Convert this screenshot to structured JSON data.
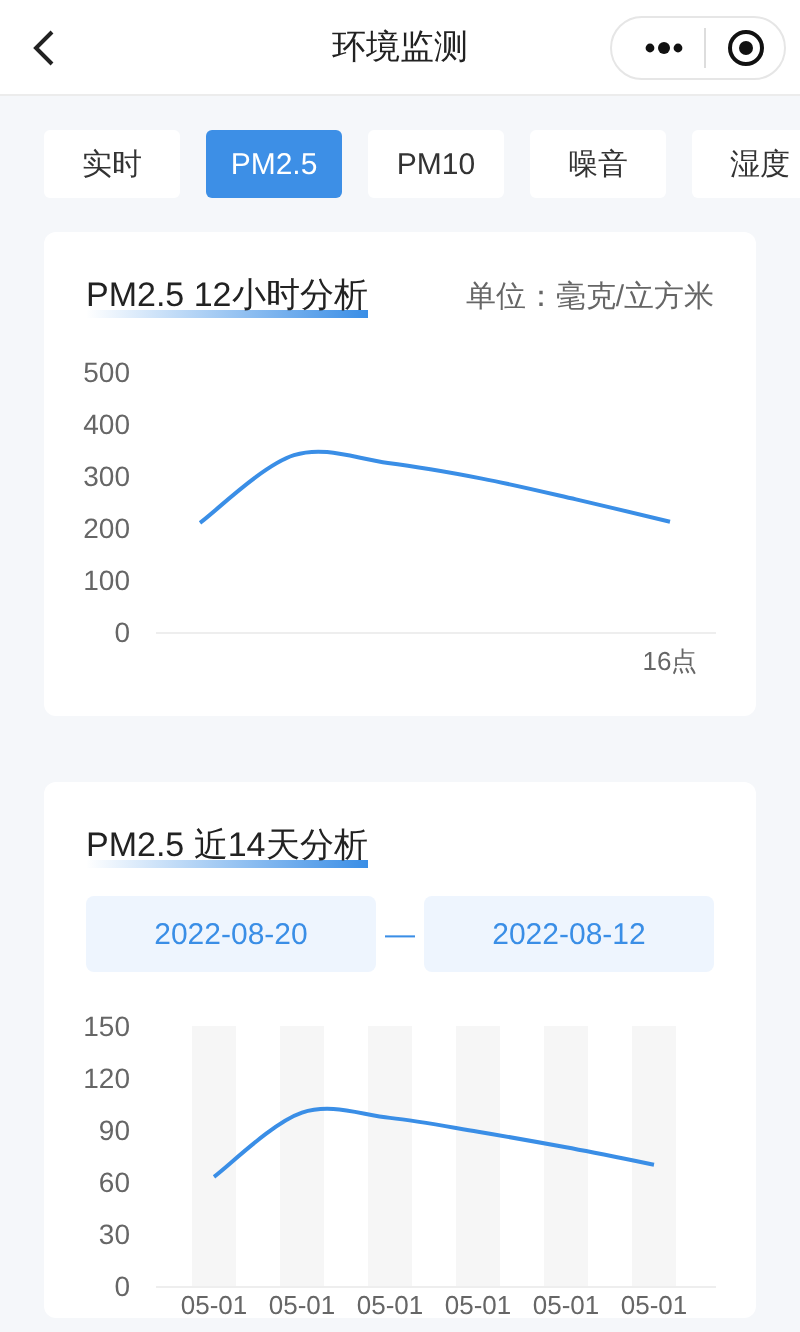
{
  "header": {
    "title": "环境监测"
  },
  "tabs": [
    {
      "label": "实时",
      "selected": false
    },
    {
      "label": "PM2.5",
      "selected": true
    },
    {
      "label": "PM10",
      "selected": false
    },
    {
      "label": "噪音",
      "selected": false
    },
    {
      "label": "湿度",
      "selected": false
    }
  ],
  "cards": [
    {
      "title": "PM2.5 12小时分析",
      "unit": "单位：毫克/立方米",
      "chart_data": {
        "type": "line",
        "xlabel": "16点",
        "ylim": [
          0,
          500
        ],
        "yticks": [
          0,
          100,
          200,
          300,
          400,
          500
        ],
        "series": [
          {
            "color": "#3a8ee6",
            "values": [
              210,
              340,
              325,
              295,
              255,
              212
            ]
          }
        ]
      }
    },
    {
      "title": "PM2.5 近14天分析",
      "date_range": {
        "start": "2022-08-20",
        "separator": "—",
        "end": "2022-08-12"
      },
      "chart_data": {
        "type": "line",
        "categories": [
          "05-01",
          "05-01",
          "05-01",
          "05-01",
          "05-01",
          "05-01"
        ],
        "ylim": [
          0,
          150
        ],
        "yticks": [
          0,
          30,
          60,
          90,
          120,
          150
        ],
        "series": [
          {
            "color": "#3a8ee6",
            "values": [
              63,
              100,
              97,
              89,
              80,
              70
            ]
          }
        ]
      }
    }
  ]
}
